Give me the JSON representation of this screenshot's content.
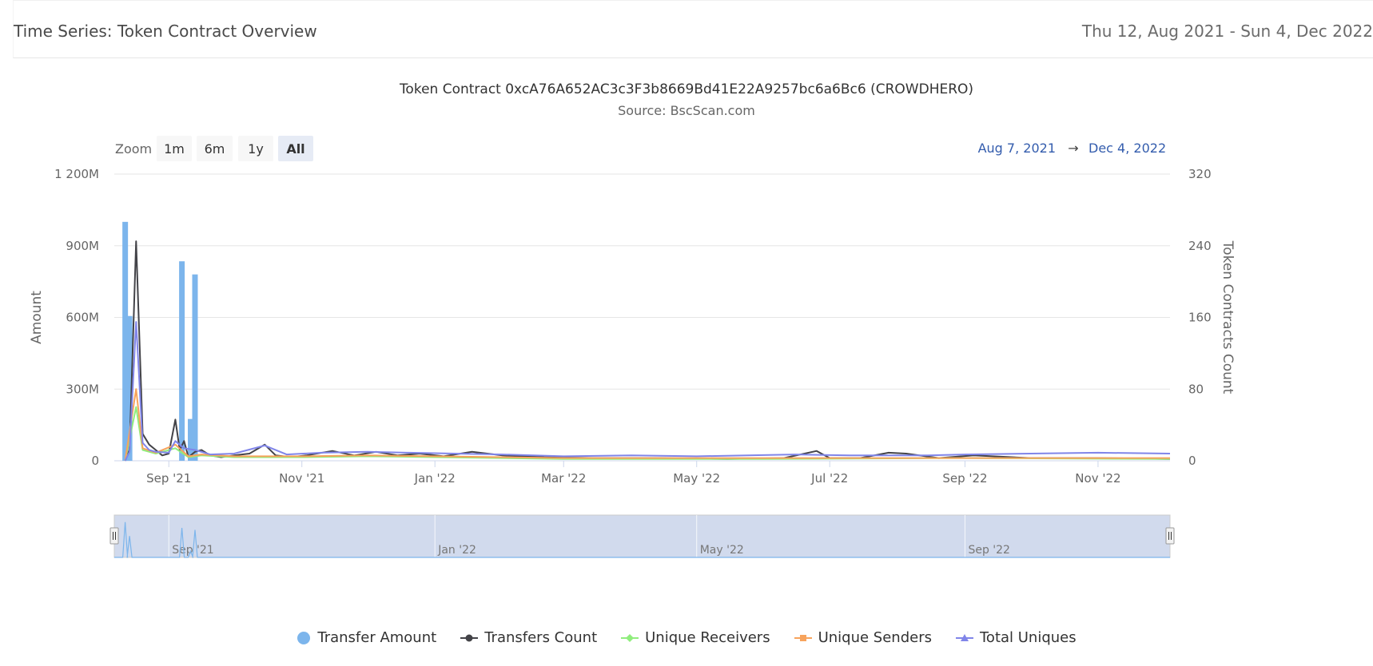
{
  "header": {
    "title": "Time Series: Token Contract Overview",
    "date_range": "Thu 12, Aug 2021 - Sun 4, Dec 2022"
  },
  "range_selector": {
    "zoom_label": "Zoom",
    "buttons": [
      "1m",
      "6m",
      "1y",
      "All"
    ],
    "selected": "All",
    "from": "Aug 7, 2021",
    "arrow": "→",
    "to": "Dec 4, 2022"
  },
  "chart_data": {
    "type": "bar",
    "title": "Token Contract 0xcA76A652AC3c3F3b8669Bd41E22A9257bc6a6Bc6 (CROWDHERO)",
    "subtitle": "Source: BscScan.com",
    "x_range": [
      "2021-08-07",
      "2022-12-04"
    ],
    "x_ticks": [
      {
        "date": "2021-09-01",
        "label": "Sep '21"
      },
      {
        "date": "2021-11-01",
        "label": "Nov '21"
      },
      {
        "date": "2022-01-01",
        "label": "Jan '22"
      },
      {
        "date": "2022-03-01",
        "label": "Mar '22"
      },
      {
        "date": "2022-05-01",
        "label": "May '22"
      },
      {
        "date": "2022-07-01",
        "label": "Jul '22"
      },
      {
        "date": "2022-09-01",
        "label": "Sep '22"
      },
      {
        "date": "2022-11-01",
        "label": "Nov '22"
      }
    ],
    "y_left": {
      "label": "Amount",
      "ylim": [
        0,
        1200000000
      ],
      "ticks": [
        0,
        300000000,
        600000000,
        900000000,
        1200000000
      ],
      "tick_labels": [
        "0",
        "300M",
        "600M",
        "900M",
        "1 200M"
      ]
    },
    "y_right": {
      "label": "Token Contracts Count",
      "ylim": [
        0,
        320
      ],
      "ticks": [
        0,
        80,
        160,
        240,
        320
      ],
      "tick_labels": [
        "0",
        "80",
        "160",
        "240",
        "320"
      ]
    },
    "grid": true,
    "legend_position": "bottom",
    "series": [
      {
        "name": "Transfer Amount",
        "type": "column",
        "axis": "left",
        "color": "#7cb5ec",
        "points": [
          [
            "2021-08-12",
            1000000000
          ],
          [
            "2021-08-14",
            606000000
          ],
          [
            "2021-09-07",
            835000000
          ],
          [
            "2021-09-11",
            175000000
          ],
          [
            "2021-09-13",
            780000000
          ]
        ]
      },
      {
        "name": "Transfers Count",
        "type": "line",
        "axis": "right",
        "color": "#434348",
        "points": [
          [
            "2021-08-12",
            0
          ],
          [
            "2021-08-14",
            12
          ],
          [
            "2021-08-17",
            245
          ],
          [
            "2021-08-20",
            30
          ],
          [
            "2021-08-23",
            18
          ],
          [
            "2021-08-26",
            12
          ],
          [
            "2021-08-29",
            6
          ],
          [
            "2021-09-01",
            8
          ],
          [
            "2021-09-04",
            46
          ],
          [
            "2021-09-06",
            12
          ],
          [
            "2021-09-08",
            22
          ],
          [
            "2021-09-10",
            4
          ],
          [
            "2021-09-13",
            10
          ],
          [
            "2021-09-16",
            12
          ],
          [
            "2021-09-20",
            6
          ],
          [
            "2021-09-25",
            4
          ],
          [
            "2021-10-01",
            6
          ],
          [
            "2021-10-08",
            8
          ],
          [
            "2021-10-15",
            18
          ],
          [
            "2021-10-20",
            6
          ],
          [
            "2021-10-27",
            4
          ],
          [
            "2021-11-03",
            6
          ],
          [
            "2021-11-15",
            11
          ],
          [
            "2021-11-25",
            6
          ],
          [
            "2021-12-05",
            10
          ],
          [
            "2021-12-15",
            6
          ],
          [
            "2021-12-25",
            8
          ],
          [
            "2022-01-05",
            5
          ],
          [
            "2022-01-18",
            10
          ],
          [
            "2022-02-01",
            6
          ],
          [
            "2022-02-20",
            4
          ],
          [
            "2022-03-15",
            3
          ],
          [
            "2022-04-15",
            3
          ],
          [
            "2022-05-15",
            2
          ],
          [
            "2022-06-10",
            3
          ],
          [
            "2022-06-25",
            11
          ],
          [
            "2022-07-01",
            3
          ],
          [
            "2022-07-15",
            3
          ],
          [
            "2022-07-28",
            9
          ],
          [
            "2022-08-05",
            8
          ],
          [
            "2022-08-20",
            3
          ],
          [
            "2022-09-05",
            6
          ],
          [
            "2022-10-01",
            3
          ],
          [
            "2022-11-01",
            3
          ],
          [
            "2022-12-04",
            2
          ]
        ]
      },
      {
        "name": "Unique Receivers",
        "type": "line",
        "axis": "right",
        "color": "#90ed7d",
        "points": [
          [
            "2021-08-12",
            0
          ],
          [
            "2021-08-17",
            60
          ],
          [
            "2021-08-20",
            12
          ],
          [
            "2021-08-26",
            8
          ],
          [
            "2021-09-04",
            14
          ],
          [
            "2021-09-10",
            4
          ],
          [
            "2021-09-16",
            6
          ],
          [
            "2021-10-01",
            4
          ],
          [
            "2021-11-01",
            4
          ],
          [
            "2021-12-01",
            5
          ],
          [
            "2022-01-01",
            4
          ],
          [
            "2022-03-01",
            2
          ],
          [
            "2022-06-01",
            2
          ],
          [
            "2022-09-01",
            3
          ],
          [
            "2022-12-04",
            2
          ]
        ]
      },
      {
        "name": "Unique Senders",
        "type": "line",
        "axis": "right",
        "color": "#f7a35c",
        "points": [
          [
            "2021-08-12",
            0
          ],
          [
            "2021-08-17",
            80
          ],
          [
            "2021-08-20",
            14
          ],
          [
            "2021-08-26",
            9
          ],
          [
            "2021-09-04",
            18
          ],
          [
            "2021-09-10",
            5
          ],
          [
            "2021-09-16",
            7
          ],
          [
            "2021-10-01",
            5
          ],
          [
            "2021-11-01",
            5
          ],
          [
            "2021-12-01",
            6
          ],
          [
            "2022-01-01",
            5
          ],
          [
            "2022-03-01",
            3
          ],
          [
            "2022-06-01",
            3
          ],
          [
            "2022-09-01",
            3
          ],
          [
            "2022-12-04",
            3
          ]
        ]
      },
      {
        "name": "Total Uniques",
        "type": "line",
        "axis": "right",
        "color": "#8085e9",
        "points": [
          [
            "2021-08-12",
            0
          ],
          [
            "2021-08-14",
            10
          ],
          [
            "2021-08-17",
            155
          ],
          [
            "2021-08-20",
            20
          ],
          [
            "2021-08-23",
            12
          ],
          [
            "2021-08-26",
            10
          ],
          [
            "2021-09-01",
            9
          ],
          [
            "2021-09-04",
            22
          ],
          [
            "2021-09-08",
            14
          ],
          [
            "2021-09-13",
            12
          ],
          [
            "2021-09-20",
            7
          ],
          [
            "2021-10-01",
            8
          ],
          [
            "2021-10-15",
            17
          ],
          [
            "2021-10-25",
            7
          ],
          [
            "2021-11-10",
            9
          ],
          [
            "2021-12-01",
            10
          ],
          [
            "2021-12-20",
            9
          ],
          [
            "2022-01-10",
            8
          ],
          [
            "2022-02-01",
            7
          ],
          [
            "2022-03-01",
            5
          ],
          [
            "2022-04-01",
            6
          ],
          [
            "2022-05-01",
            5
          ],
          [
            "2022-06-15",
            7
          ],
          [
            "2022-07-10",
            6
          ],
          [
            "2022-08-15",
            6
          ],
          [
            "2022-09-01",
            7
          ],
          [
            "2022-10-01",
            8
          ],
          [
            "2022-11-01",
            9
          ],
          [
            "2022-12-04",
            8
          ]
        ]
      }
    ],
    "navigator": {
      "labels": [
        {
          "date": "2021-09-01",
          "label": "Sep '21"
        },
        {
          "date": "2022-01-01",
          "label": "Jan '22"
        },
        {
          "date": "2022-05-01",
          "label": "May '22"
        },
        {
          "date": "2022-09-01",
          "label": "Sep '22"
        }
      ]
    }
  }
}
